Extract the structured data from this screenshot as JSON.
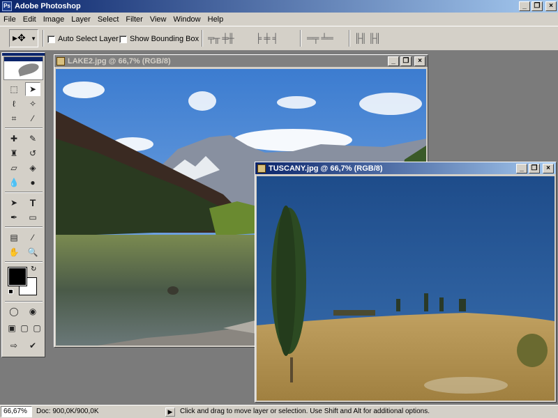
{
  "app": {
    "title": "Adobe Photoshop"
  },
  "window_controls": {
    "minimize": "_",
    "restore": "❐",
    "close": "×"
  },
  "menu": [
    "File",
    "Edit",
    "Image",
    "Layer",
    "Select",
    "Filter",
    "View",
    "Window",
    "Help"
  ],
  "options": {
    "tool_icon": "move-tool-icon",
    "auto_select_layer": {
      "label": "Auto Select Layer",
      "checked": false
    },
    "show_bounding_box": {
      "label": "Show Bounding Box",
      "checked": false
    }
  },
  "documents": [
    {
      "title": "LAKE2.jpg @ 66,7% (RGB/8)",
      "active": false
    },
    {
      "title": "TUSCANY.jpg @ 66,7% (RGB/8)",
      "active": true
    }
  ],
  "status": {
    "zoom": "66,67%",
    "doc": "Doc: 900,0K/900,0K",
    "message": "Click and drag to move layer or selection.  Use Shift and Alt for additional options."
  },
  "colors": {
    "foreground": "#000000",
    "background": "#ffffff",
    "title_active": "#0a246a",
    "title_inactive": "#808080"
  }
}
